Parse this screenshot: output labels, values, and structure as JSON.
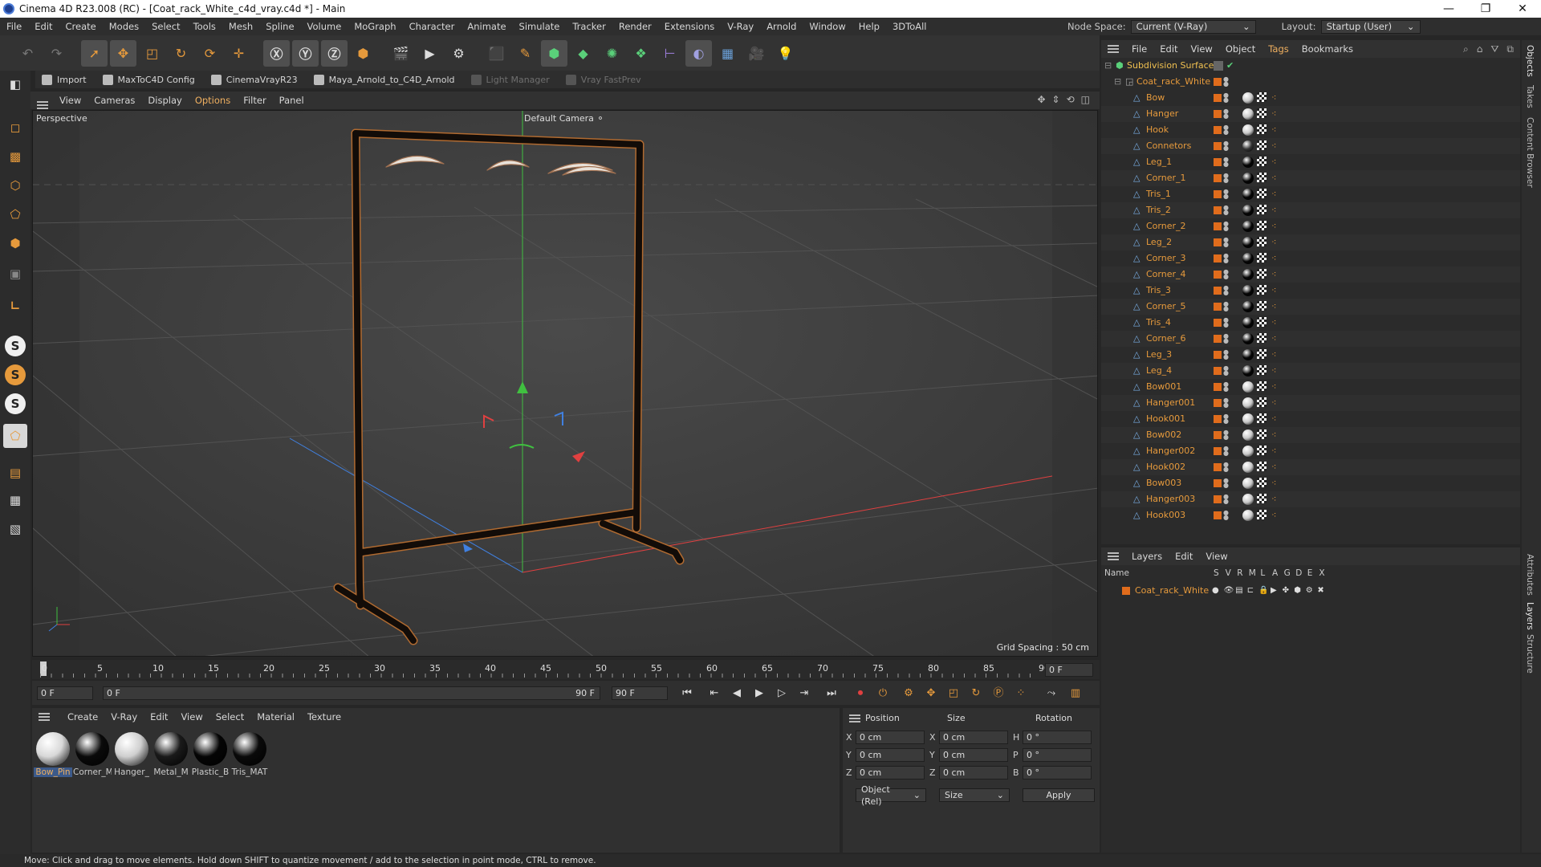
{
  "window": {
    "title": "Cinema 4D R23.008 (RC) - [Coat_rack_White_c4d_vray.c4d *] - Main",
    "min": "—",
    "max": "❐",
    "close": "✕"
  },
  "menu": [
    "File",
    "Edit",
    "Create",
    "Modes",
    "Select",
    "Tools",
    "Mesh",
    "Spline",
    "Volume",
    "MoGraph",
    "Character",
    "Animate",
    "Simulate",
    "Tracker",
    "Render",
    "Extensions",
    "V-Ray",
    "Arnold",
    "Window",
    "Help",
    "3DToAll"
  ],
  "nodespace": {
    "label": "Node Space:",
    "value": "Current (V-Ray)",
    "layout_label": "Layout:",
    "layout_value": "Startup (User)"
  },
  "plugins": [
    {
      "label": "Import",
      "enabled": true
    },
    {
      "label": "MaxToC4D Config",
      "enabled": true
    },
    {
      "label": "CinemaVrayR23",
      "enabled": true
    },
    {
      "label": "Maya_Arnold_to_C4D_Arnold",
      "enabled": true
    },
    {
      "label": "Light Manager",
      "enabled": false
    },
    {
      "label": "Vray FastPrev",
      "enabled": false
    }
  ],
  "viewport": {
    "menu": [
      "View",
      "Cameras",
      "Display",
      "Options",
      "Filter",
      "Panel"
    ],
    "active_menu": "Options",
    "label": "Perspective",
    "camera": "Default Camera",
    "grid_spacing": "Grid Spacing : 50 cm"
  },
  "timeline": {
    "ticks": [
      "0",
      "5",
      "10",
      "15",
      "20",
      "25",
      "30",
      "35",
      "40",
      "45",
      "50",
      "55",
      "60",
      "65",
      "70",
      "75",
      "80",
      "85",
      "90"
    ],
    "end_field": "0 F"
  },
  "transport": {
    "start": "0 F",
    "current": "0 F",
    "end_inner": "90 F",
    "end": "90 F"
  },
  "materials": {
    "menu": [
      "Create",
      "V-Ray",
      "Edit",
      "View",
      "Select",
      "Material",
      "Texture"
    ],
    "items": [
      {
        "name": "Bow_Pin",
        "color": "#d8d8d8",
        "selected": true
      },
      {
        "name": "Corner_M",
        "color": "#0a0a0a",
        "selected": false
      },
      {
        "name": "Hanger_",
        "color": "#cfcfcf",
        "selected": false
      },
      {
        "name": "Metal_M",
        "color": "#1a1a1a",
        "selected": false
      },
      {
        "name": "Plastic_B",
        "color": "#050505",
        "selected": false
      },
      {
        "name": "Tris_MAT",
        "color": "#0a0a0a",
        "selected": false
      }
    ]
  },
  "attributes": {
    "headers": {
      "position": "Position",
      "size": "Size",
      "rotation": "Rotation"
    },
    "rows": [
      {
        "axis": "X",
        "pos": "0 cm",
        "saxis": "X",
        "size": "0 cm",
        "raxis": "H",
        "rot": "0 °"
      },
      {
        "axis": "Y",
        "pos": "0 cm",
        "saxis": "Y",
        "size": "0 cm",
        "raxis": "P",
        "rot": "0 °"
      },
      {
        "axis": "Z",
        "pos": "0 cm",
        "saxis": "Z",
        "size": "0 cm",
        "raxis": "B",
        "rot": "0 °"
      }
    ],
    "coord_mode": "Object (Rel)",
    "size_mode": "Size",
    "apply": "Apply"
  },
  "objects": {
    "menu": [
      "File",
      "Edit",
      "View",
      "Object",
      "Tags",
      "Bookmarks"
    ],
    "active_menu": "Tags",
    "root": "Subdivision Surface",
    "group": "Coat_rack_White",
    "items": [
      {
        "name": "Bow",
        "mat": "#c8c8c8"
      },
      {
        "name": "Hanger",
        "mat": "#c8c8c8"
      },
      {
        "name": "Hook",
        "mat": "#c8c8c8"
      },
      {
        "name": "Connetors",
        "mat": "#333333"
      },
      {
        "name": "Leg_1",
        "mat": "#050505"
      },
      {
        "name": "Corner_1",
        "mat": "#050505"
      },
      {
        "name": "Tris_1",
        "mat": "#050505"
      },
      {
        "name": "Tris_2",
        "mat": "#050505"
      },
      {
        "name": "Corner_2",
        "mat": "#050505"
      },
      {
        "name": "Leg_2",
        "mat": "#050505"
      },
      {
        "name": "Corner_3",
        "mat": "#050505"
      },
      {
        "name": "Corner_4",
        "mat": "#050505"
      },
      {
        "name": "Tris_3",
        "mat": "#050505"
      },
      {
        "name": "Corner_5",
        "mat": "#050505"
      },
      {
        "name": "Tris_4",
        "mat": "#050505"
      },
      {
        "name": "Corner_6",
        "mat": "#050505"
      },
      {
        "name": "Leg_3",
        "mat": "#050505"
      },
      {
        "name": "Leg_4",
        "mat": "#050505"
      },
      {
        "name": "Bow001",
        "mat": "#c8c8c8"
      },
      {
        "name": "Hanger001",
        "mat": "#c8c8c8"
      },
      {
        "name": "Hook001",
        "mat": "#c8c8c8"
      },
      {
        "name": "Bow002",
        "mat": "#c8c8c8"
      },
      {
        "name": "Hanger002",
        "mat": "#c8c8c8"
      },
      {
        "name": "Hook002",
        "mat": "#c8c8c8"
      },
      {
        "name": "Bow003",
        "mat": "#c8c8c8"
      },
      {
        "name": "Hanger003",
        "mat": "#c8c8c8"
      },
      {
        "name": "Hook003",
        "mat": "#c8c8c8"
      }
    ]
  },
  "layers": {
    "menu": [
      "Layers",
      "Edit",
      "View"
    ],
    "columns": [
      "Name",
      "S",
      "V",
      "R",
      "M",
      "L",
      "A",
      "G",
      "D",
      "E",
      "X"
    ],
    "items": [
      {
        "name": "Coat_rack_White"
      }
    ]
  },
  "right_tabs_top": [
    "Objects",
    "Takes",
    "Content Browser"
  ],
  "right_tabs_bottom": [
    "Attributes",
    "Layers",
    "Structure"
  ],
  "status": "Move: Click and drag to move elements. Hold down SHIFT to quantize movement / add to the selection in point mode, CTRL to remove.",
  "colors": {
    "accent": "#e69a3c",
    "rack": "#1a120c",
    "axis_x": "#e04040",
    "axis_y": "#40c040",
    "axis_z": "#4080e0"
  }
}
